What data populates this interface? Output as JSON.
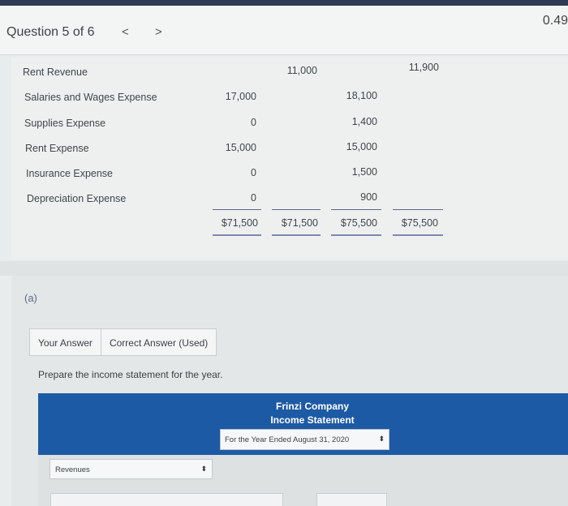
{
  "header": {
    "question_title": "Question 5 of 6",
    "prev_glyph": "<",
    "next_glyph": ">",
    "score": "0.49"
  },
  "trial_balance": {
    "rows": [
      {
        "label": "Rent Revenue",
        "c1": "",
        "c2": "11,000",
        "c3": "",
        "c4": "11,900"
      },
      {
        "label": "Salaries and Wages Expense",
        "c1": "17,000",
        "c2": "",
        "c3": "18,100",
        "c4": ""
      },
      {
        "label": "Supplies Expense",
        "c1": "0",
        "c2": "",
        "c3": "1,400",
        "c4": ""
      },
      {
        "label": "Rent Expense",
        "c1": "15,000",
        "c2": "",
        "c3": "15,000",
        "c4": ""
      },
      {
        "label": "Insurance Expense",
        "c1": "0",
        "c2": "",
        "c3": "1,500",
        "c4": ""
      },
      {
        "label": "Depreciation Expense",
        "c1": "0",
        "c2": "",
        "c3": "900",
        "c4": ""
      }
    ],
    "totals": [
      "$71,500",
      "$71,500",
      "$75,500",
      "$75,500"
    ]
  },
  "part": {
    "label": "(a)",
    "tabs": [
      "Your Answer",
      "Correct Answer (Used)"
    ],
    "prompt": "Prepare the income statement for the year."
  },
  "statement": {
    "company": "Frinzi Company",
    "title": "Income Statement",
    "period": "For the Year Ended August 31, 2020",
    "revenue_select": "Revenues"
  },
  "colors": {
    "header_blue": "#1d5aa5",
    "top_accent": "#2d3b55"
  }
}
